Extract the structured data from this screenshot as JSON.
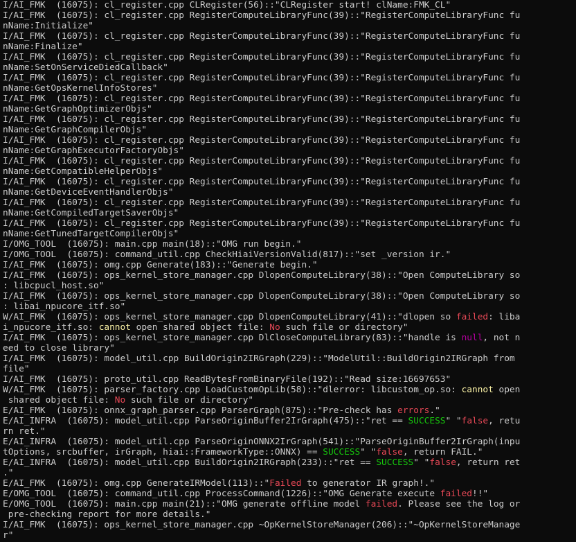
{
  "terminal": {
    "colors": {
      "background": "#0c0c0c",
      "text": "#cccccc",
      "red": "#e74856",
      "yellow": "#f9f1a5",
      "green": "#16c60c",
      "magenta": "#b4009e"
    },
    "lines": [
      [
        {
          "t": "I/AI_FMK  (16075): cl_register.cpp CLRegister(56)::\"CLRegister start! clName:FMK_CL\"",
          "c": "text"
        }
      ],
      [
        {
          "t": "I/AI_FMK  (16075): cl_register.cpp RegisterComputeLibraryFunc(39)::\"RegisterComputeLibraryFunc fu",
          "c": "text"
        }
      ],
      [
        {
          "t": "nName:Initialize\"",
          "c": "text"
        }
      ],
      [
        {
          "t": "I/AI_FMK  (16075): cl_register.cpp RegisterComputeLibraryFunc(39)::\"RegisterComputeLibraryFunc fu",
          "c": "text"
        }
      ],
      [
        {
          "t": "nName:Finalize\"",
          "c": "text"
        }
      ],
      [
        {
          "t": "I/AI_FMK  (16075): cl_register.cpp RegisterComputeLibraryFunc(39)::\"RegisterComputeLibraryFunc fu",
          "c": "text"
        }
      ],
      [
        {
          "t": "nName:SetOnServiceDiedCallback\"",
          "c": "text"
        }
      ],
      [
        {
          "t": "I/AI_FMK  (16075): cl_register.cpp RegisterComputeLibraryFunc(39)::\"RegisterComputeLibraryFunc fu",
          "c": "text"
        }
      ],
      [
        {
          "t": "nName:GetOpsKernelInfoStores\"",
          "c": "text"
        }
      ],
      [
        {
          "t": "I/AI_FMK  (16075): cl_register.cpp RegisterComputeLibraryFunc(39)::\"RegisterComputeLibraryFunc fu",
          "c": "text"
        }
      ],
      [
        {
          "t": "nName:GetGraphOptimizerObjs\"",
          "c": "text"
        }
      ],
      [
        {
          "t": "I/AI_FMK  (16075): cl_register.cpp RegisterComputeLibraryFunc(39)::\"RegisterComputeLibraryFunc fu",
          "c": "text"
        }
      ],
      [
        {
          "t": "nName:GetGraphCompilerObjs\"",
          "c": "text"
        }
      ],
      [
        {
          "t": "I/AI_FMK  (16075): cl_register.cpp RegisterComputeLibraryFunc(39)::\"RegisterComputeLibraryFunc fu",
          "c": "text"
        }
      ],
      [
        {
          "t": "nName:GetGraphExecutorFactoryObjs\"",
          "c": "text"
        }
      ],
      [
        {
          "t": "I/AI_FMK  (16075): cl_register.cpp RegisterComputeLibraryFunc(39)::\"RegisterComputeLibraryFunc fu",
          "c": "text"
        }
      ],
      [
        {
          "t": "nName:GetCompatibleHelperObjs\"",
          "c": "text"
        }
      ],
      [
        {
          "t": "I/AI_FMK  (16075): cl_register.cpp RegisterComputeLibraryFunc(39)::\"RegisterComputeLibraryFunc fu",
          "c": "text"
        }
      ],
      [
        {
          "t": "nName:GetDeviceEventHandlerObjs\"",
          "c": "text"
        }
      ],
      [
        {
          "t": "I/AI_FMK  (16075): cl_register.cpp RegisterComputeLibraryFunc(39)::\"RegisterComputeLibraryFunc fu",
          "c": "text"
        }
      ],
      [
        {
          "t": "nName:GetCompiledTargetSaverObjs\"",
          "c": "text"
        }
      ],
      [
        {
          "t": "I/AI_FMK  (16075): cl_register.cpp RegisterComputeLibraryFunc(39)::\"RegisterComputeLibraryFunc fu",
          "c": "text"
        }
      ],
      [
        {
          "t": "nName:GetTunedTargetCompilerObjs\"",
          "c": "text"
        }
      ],
      [
        {
          "t": "I/OMG_TOOL  (16075): main.cpp main(18)::\"OMG run begin.\"",
          "c": "text"
        }
      ],
      [
        {
          "t": "I/OMG_TOOL  (16075): command_util.cpp CheckHiaiVersionValid(817)::\"set _version ir.\"",
          "c": "text"
        }
      ],
      [
        {
          "t": "I/AI_FMK  (16075): omg.cpp Generate(183)::\"Generate begin.\"",
          "c": "text"
        }
      ],
      [
        {
          "t": "I/AI_FMK  (16075): ops_kernel_store_manager.cpp DlopenComputeLibrary(38)::\"Open ComputeLibrary so",
          "c": "text"
        }
      ],
      [
        {
          "t": ": libcpucl_host.so\"",
          "c": "text"
        }
      ],
      [
        {
          "t": "I/AI_FMK  (16075): ops_kernel_store_manager.cpp DlopenComputeLibrary(38)::\"Open ComputeLibrary so",
          "c": "text"
        }
      ],
      [
        {
          "t": ": libai_npucore_itf.so\"",
          "c": "text"
        }
      ],
      [
        {
          "t": "W/AI_FMK  (16075): ops_kernel_store_manager.cpp DlopenComputeLibrary(41)::\"dlopen so ",
          "c": "text"
        },
        {
          "t": "failed",
          "c": "red"
        },
        {
          "t": ": liba",
          "c": "text"
        }
      ],
      [
        {
          "t": "i_npucore_itf.so: ",
          "c": "text"
        },
        {
          "t": "cannot",
          "c": "yellow"
        },
        {
          "t": " open shared object file: ",
          "c": "text"
        },
        {
          "t": "No",
          "c": "red"
        },
        {
          "t": " such file or directory\"",
          "c": "text"
        }
      ],
      [
        {
          "t": "I/AI_FMK  (16075): ops_kernel_store_manager.cpp DlCloseComputeLibrary(83)::\"handle is ",
          "c": "text"
        },
        {
          "t": "null",
          "c": "magenta"
        },
        {
          "t": ", not n",
          "c": "text"
        }
      ],
      [
        {
          "t": "eed to close library\"",
          "c": "text"
        }
      ],
      [
        {
          "t": "I/AI_FMK  (16075): model_util.cpp BuildOrigin2IRGraph(229)::\"ModelUtil::BuildOrigin2IRGraph from",
          "c": "text"
        }
      ],
      [
        {
          "t": "file\"",
          "c": "text"
        }
      ],
      [
        {
          "t": "I/AI_FMK  (16075): proto_util.cpp ReadBytesFromBinaryFile(192)::\"Read size:16697653\"",
          "c": "text"
        }
      ],
      [
        {
          "t": "W/AI_FMK  (16075): parser_factory.cpp LoadCustomOpLib(58)::\"dlerror: libcustom_op.so: ",
          "c": "text"
        },
        {
          "t": "cannot",
          "c": "yellow"
        },
        {
          "t": " open",
          "c": "text"
        }
      ],
      [
        {
          "t": " shared object file: ",
          "c": "text"
        },
        {
          "t": "No",
          "c": "red"
        },
        {
          "t": " such file or directory\"",
          "c": "text"
        }
      ],
      [
        {
          "t": "E/AI_FMK  (16075): onnx_graph_parser.cpp ParserGraph(875)::\"Pre-check has ",
          "c": "text"
        },
        {
          "t": "errors",
          "c": "red"
        },
        {
          "t": ".\"",
          "c": "text"
        }
      ],
      [
        {
          "t": "E/AI_INFRA  (16075): model_util.cpp ParseOriginBuffer2IrGraph(475)::\"ret == ",
          "c": "text"
        },
        {
          "t": "SUCCESS",
          "c": "green"
        },
        {
          "t": "\" \"",
          "c": "text"
        },
        {
          "t": "false",
          "c": "red"
        },
        {
          "t": ", retu",
          "c": "text"
        }
      ],
      [
        {
          "t": "rn ret.\"",
          "c": "text"
        }
      ],
      [
        {
          "t": "E/AI_INFRA  (16075): model_util.cpp ParseOriginONNX2IrGraph(541)::\"ParseOriginBuffer2IrGraph(inpu",
          "c": "text"
        }
      ],
      [
        {
          "t": "tOptions, srcbuffer, irGraph, hiai::FrameworkType::ONNX) == ",
          "c": "text"
        },
        {
          "t": "SUCCESS",
          "c": "green"
        },
        {
          "t": "\" \"",
          "c": "text"
        },
        {
          "t": "false",
          "c": "red"
        },
        {
          "t": ", return FAIL.\"",
          "c": "text"
        }
      ],
      [
        {
          "t": "E/AI_INFRA  (16075): model_util.cpp BuildOrigin2IRGraph(233)::\"ret == ",
          "c": "text"
        },
        {
          "t": "SUCCESS",
          "c": "green"
        },
        {
          "t": "\" \"",
          "c": "text"
        },
        {
          "t": "false",
          "c": "red"
        },
        {
          "t": ", return ret",
          "c": "text"
        }
      ],
      [
        {
          "t": ".\"",
          "c": "text"
        }
      ],
      [
        {
          "t": "E/AI_FMK  (16075): omg.cpp GenerateIRModel(113)::\"",
          "c": "text"
        },
        {
          "t": "Failed",
          "c": "red"
        },
        {
          "t": " to generator IR graph!.\"",
          "c": "text"
        }
      ],
      [
        {
          "t": "E/OMG_TOOL  (16075): command_util.cpp ProcessCommand(1226)::\"OMG Generate execute ",
          "c": "text"
        },
        {
          "t": "failed",
          "c": "red"
        },
        {
          "t": "!!\"",
          "c": "text"
        }
      ],
      [
        {
          "t": "E/OMG_TOOL  (16075): main.cpp main(21)::\"OMG generate offline model ",
          "c": "text"
        },
        {
          "t": "failed",
          "c": "red"
        },
        {
          "t": ". Please see the log or",
          "c": "text"
        }
      ],
      [
        {
          "t": " pre-checking report for more details.\"",
          "c": "text"
        }
      ],
      [
        {
          "t": "I/AI_FMK  (16075): ops_kernel_store_manager.cpp ~OpKernelStoreManager(206)::\"~OpKernelStoreManage",
          "c": "text"
        }
      ],
      [
        {
          "t": "r\"",
          "c": "text"
        }
      ]
    ]
  }
}
